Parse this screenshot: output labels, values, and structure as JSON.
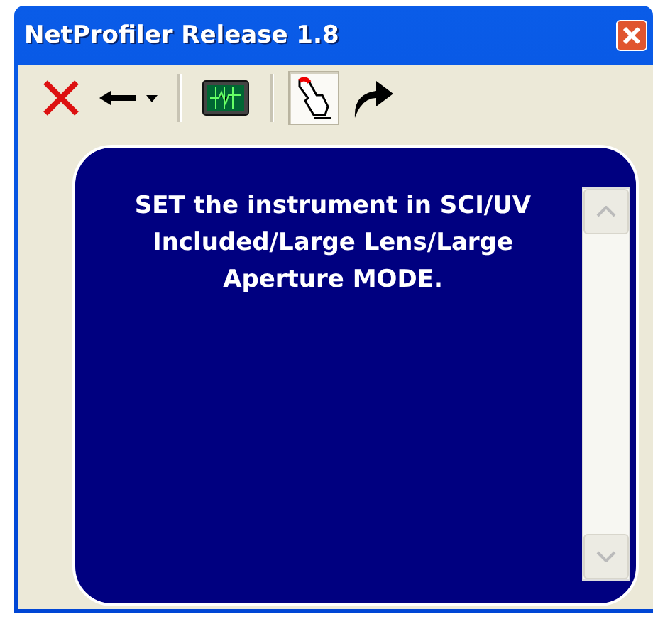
{
  "window": {
    "title": "NetProfiler Release 1.8"
  },
  "toolbar": {
    "buttons": [
      {
        "kind": "delete",
        "selected": false
      },
      {
        "kind": "back",
        "selected": false
      },
      {
        "kind": "separator"
      },
      {
        "kind": "monitor",
        "selected": false
      },
      {
        "kind": "separator"
      },
      {
        "kind": "pointer",
        "selected": true
      },
      {
        "kind": "forward",
        "selected": false
      }
    ]
  },
  "message": {
    "text": "SET the instrument in SCI/UV Included/Large Lens/Large Aperture MODE."
  }
}
